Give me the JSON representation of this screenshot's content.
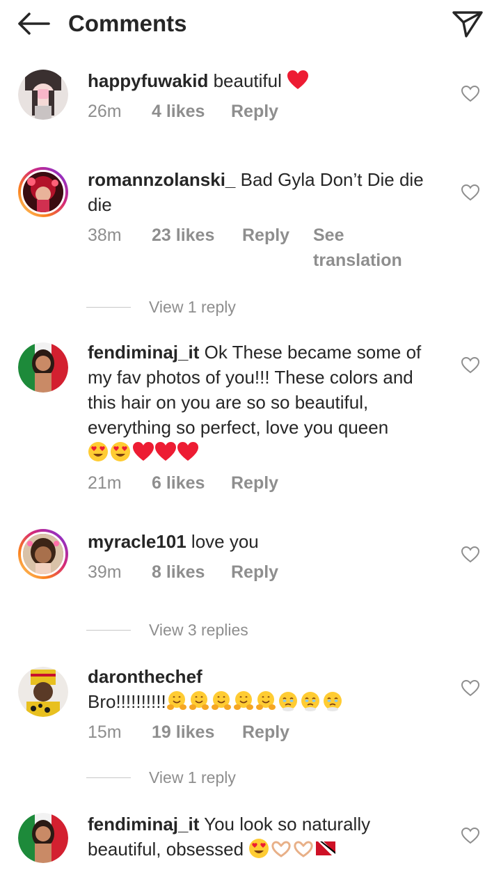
{
  "header": {
    "title": "Comments",
    "back_icon": "arrow-left-icon",
    "share_icon": "paper-plane-icon"
  },
  "comments": [
    {
      "username": "happyfuwakid",
      "text": "beautiful",
      "time": "26m",
      "likes": "4 likes",
      "reply": "Reply",
      "emojis": [
        "red-heart"
      ]
    },
    {
      "username": "romannzolanski_",
      "text": "Bad Gyla Don’t Die die die",
      "time": "38m",
      "likes": "23 likes",
      "reply": "Reply",
      "see_translation_1": "See",
      "see_translation_2": "translation",
      "view_replies": "View 1 reply"
    },
    {
      "username": "fendiminaj_it",
      "text_line1": "Ok These became some of",
      "text_line2": "my fav photos of you!!! These colors and",
      "text_line3": "this hair on you are so so beautiful,",
      "text_line4": "everything so perfect, love you queen",
      "time": "21m",
      "likes": "6 likes",
      "reply": "Reply",
      "emojis": [
        "heart-eyes",
        "heart-eyes",
        "red-heart",
        "red-heart",
        "red-heart"
      ]
    },
    {
      "username": "myracle101",
      "text": "love you",
      "time": "39m",
      "likes": "8 likes",
      "reply": "Reply",
      "view_replies": "View 3 replies"
    },
    {
      "username": "daronthechef",
      "text": "Bro!!!!!!!!!!",
      "time": "15m",
      "likes": "19 likes",
      "reply": "Reply",
      "emojis": [
        "hugging-face",
        "hugging-face",
        "hugging-face",
        "hugging-face",
        "hugging-face",
        "face-holding-back-tears",
        "face-holding-back-tears",
        "face-holding-back-tears"
      ],
      "view_replies": "View 1 reply"
    },
    {
      "username": "fendiminaj_it",
      "text_line1": "You look so naturally",
      "text_line2": "beautiful, obsessed",
      "emojis": [
        "heart-eyes",
        "heart-hands",
        "heart-hands",
        "flag-trinidad-tobago"
      ]
    }
  ],
  "colors": {
    "text_primary": "#262626",
    "text_secondary": "#8e8e8e",
    "heart_red": "#ed1c33"
  }
}
